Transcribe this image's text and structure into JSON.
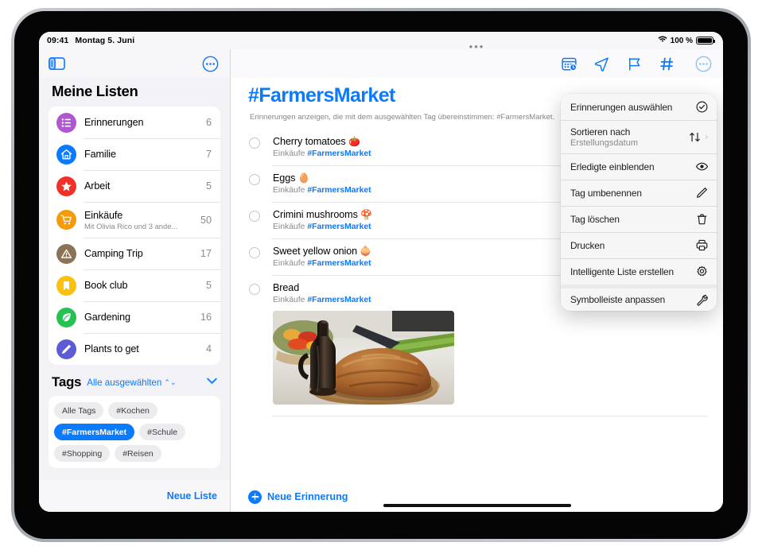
{
  "status_bar": {
    "time": "09:41",
    "date": "Montag 5. Juni",
    "wifi_icon": "wifi-icon",
    "battery_percent": "100 %",
    "battery_icon": "battery-full-icon"
  },
  "sidebar": {
    "toggle_icon": "sidebar-toggle-icon",
    "more_icon": "ellipsis-circle-icon",
    "title": "Meine Listen",
    "lists": [
      {
        "name": "Erinnerungen",
        "count": "6",
        "icon": "bulleted-list-icon",
        "color": "#b056d0",
        "subtitle": ""
      },
      {
        "name": "Familie",
        "count": "7",
        "icon": "house-icon",
        "color": "#0a7aff",
        "subtitle": ""
      },
      {
        "name": "Arbeit",
        "count": "5",
        "icon": "star-icon",
        "color": "#f03127",
        "subtitle": ""
      },
      {
        "name": "Einkäufe",
        "count": "50",
        "icon": "shopping-cart-icon",
        "color": "#f59b0b",
        "subtitle": "Mit Olivia Rico und 3 ande..."
      },
      {
        "name": "Camping Trip",
        "count": "17",
        "icon": "tent-triangle-icon",
        "color": "#8c7357",
        "subtitle": ""
      },
      {
        "name": "Book club",
        "count": "5",
        "icon": "bookmark-icon",
        "color": "#fcc10b",
        "subtitle": ""
      },
      {
        "name": "Gardening",
        "count": "16",
        "icon": "leaf-icon",
        "color": "#25c152",
        "subtitle": ""
      },
      {
        "name": "Plants to get",
        "count": "4",
        "icon": "pencil-icon",
        "color": "#5c5cd6",
        "subtitle": ""
      }
    ],
    "tags_section": {
      "label": "Tags",
      "filter_label": "Alle ausgewählten",
      "filter_icon": "up-down-chevrons-icon",
      "collapse_icon": "chevron-down-icon",
      "chips": [
        {
          "label": "Alle Tags",
          "selected": false
        },
        {
          "label": "#Kochen",
          "selected": false
        },
        {
          "label": "#FarmersMarket",
          "selected": true
        },
        {
          "label": "#Schule",
          "selected": false
        },
        {
          "label": "#Shopping",
          "selected": false
        },
        {
          "label": "#Reisen",
          "selected": false
        }
      ]
    },
    "new_list_label": "Neue Liste"
  },
  "detail": {
    "grabber_icon": "window-grabber-icon",
    "toolbar_icons": [
      {
        "name": "scheduled-calendar-icon"
      },
      {
        "name": "location-arrow-icon"
      },
      {
        "name": "flag-icon"
      },
      {
        "name": "hashtag-icon"
      }
    ],
    "more_icon": "ellipsis-circle-icon",
    "title": "#FarmersMarket",
    "subtitle": "Erinnerungen anzeigen, die mit dem ausgewählten Tag übereinstimmen: #FarmersMarket.",
    "reminders": [
      {
        "title": "Cherry tomatoes",
        "emoji": "🍅",
        "list": "Einkäufe",
        "tag": "#FarmersMarket",
        "has_photo": false
      },
      {
        "title": "Eggs",
        "emoji": "🥚",
        "list": "Einkäufe",
        "tag": "#FarmersMarket",
        "has_photo": false
      },
      {
        "title": "Crimini mushrooms",
        "emoji": "🍄",
        "list": "Einkäufe",
        "tag": "#FarmersMarket",
        "has_photo": false
      },
      {
        "title": "Sweet yellow onion",
        "emoji": "🧅",
        "list": "Einkäufe",
        "tag": "#FarmersMarket",
        "has_photo": false
      },
      {
        "title": "Bread",
        "emoji": "",
        "list": "Einkäufe",
        "tag": "#FarmersMarket",
        "has_photo": true,
        "photo_alt": "Brotlaib auf Holzbrett mit Ölflasche"
      }
    ],
    "new_reminder_label": "Neue Erinnerung",
    "add_icon": "plus-circle-icon"
  },
  "popover_menu": {
    "items": [
      {
        "label": "Erinnerungen auswählen",
        "sublabel": "",
        "icon": "checkmark-circle-icon",
        "chevron": false,
        "group_gap": false
      },
      {
        "label": "Sortieren nach",
        "sublabel": "Erstellungsdatum",
        "icon": "sort-arrows-icon",
        "chevron": true,
        "group_gap": false
      },
      {
        "label": "Erledigte einblenden",
        "sublabel": "",
        "icon": "eye-icon",
        "chevron": false,
        "group_gap": false
      },
      {
        "label": "Tag umbenennen",
        "sublabel": "",
        "icon": "pencil-line-icon",
        "chevron": false,
        "group_gap": false
      },
      {
        "label": "Tag löschen",
        "sublabel": "",
        "icon": "trash-icon",
        "chevron": false,
        "group_gap": false
      },
      {
        "label": "Drucken",
        "sublabel": "",
        "icon": "printer-icon",
        "chevron": false,
        "group_gap": false
      },
      {
        "label": "Intelligente Liste erstellen",
        "sublabel": "",
        "icon": "gear-icon",
        "chevron": false,
        "group_gap": false
      },
      {
        "label": "Symbolleiste anpassen",
        "sublabel": "",
        "icon": "wrench-icon",
        "chevron": false,
        "group_gap": true
      }
    ]
  },
  "colors": {
    "accent": "#0a7aff",
    "sidebar_bg": "#f2f2f7",
    "card_bg": "#ffffff",
    "menu_bg": "#f6f6f6",
    "secondary_text": "#8a8a8e"
  }
}
